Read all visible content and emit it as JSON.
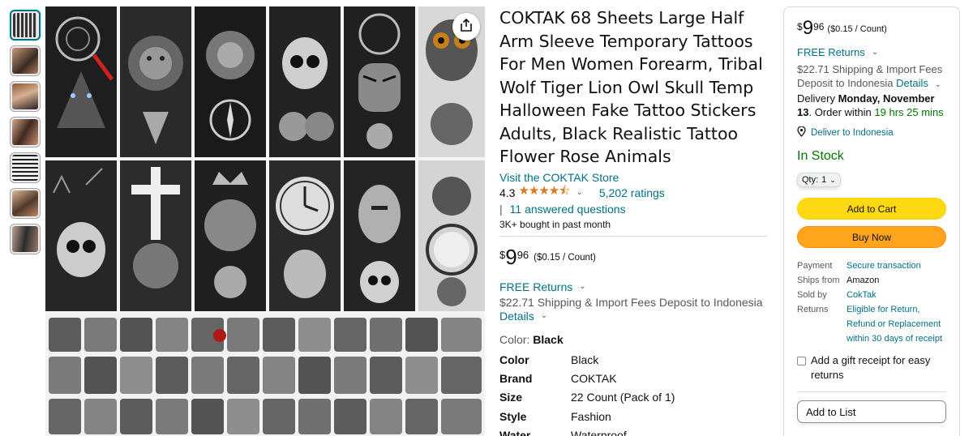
{
  "product": {
    "title": "COKTAK 68 Sheets Large Half Arm Sleeve Temporary Tattoos For Men Women Forearm, Tribal Wolf Tiger Lion Owl Skull Temp Halloween Fake Tattoo Stickers Adults, Black Realistic Tattoo Flower Rose Animals",
    "store_link": "Visit the COKTAK Store",
    "rating_value": "4.3",
    "stars": "★★★★⯪",
    "ratings_count": "5,202 ratings",
    "qa_separator": "|",
    "answered_questions": "11 answered questions",
    "bought": "3K+ bought in past month",
    "price": {
      "currency": "$",
      "whole": "9",
      "fraction": "96",
      "unit": "($0.15 / Count)"
    },
    "free_returns": "FREE Returns",
    "shipping": "$22.71 Shipping & Import Fees Deposit to Indonesia",
    "details_link": "Details",
    "color_label": "Color:",
    "color_value": "Black",
    "specs": [
      {
        "key": "Color",
        "value": "Black"
      },
      {
        "key": "Brand",
        "value": "COKTAK"
      },
      {
        "key": "Size",
        "value": "22 Count (Pack of 1)"
      },
      {
        "key": "Style",
        "value": "Fashion"
      },
      {
        "key": "Water",
        "value": "Waterproof"
      }
    ]
  },
  "buybox": {
    "price": {
      "currency": "$",
      "whole": "9",
      "fraction": "96",
      "unit": "($0.15 / Count)"
    },
    "free_returns": "FREE Returns",
    "shipping": "$22.71 Shipping & Import Fees Deposit to Indonesia",
    "details_link": "Details",
    "delivery_prefix": "Delivery",
    "delivery_date": "Monday, November 13",
    "order_within_prefix": ". Order within",
    "order_within_time": "19 hrs 25 mins",
    "deliver_to": "Deliver to Indonesia",
    "stock": "In Stock",
    "qty_label": "Qty:",
    "qty_value": "1",
    "add_to_cart": "Add to Cart",
    "buy_now": "Buy Now",
    "details": [
      {
        "key": "Payment",
        "value": "Secure transaction",
        "link": true
      },
      {
        "key": "Ships from",
        "value": "Amazon",
        "link": false
      },
      {
        "key": "Sold by",
        "value": "CokTak",
        "link": true
      },
      {
        "key": "Returns",
        "value": "Eligible for Return, Refund or Replacement within 30 days of receipt",
        "link": true
      }
    ],
    "gift_receipt": "Add a gift receipt for easy returns",
    "add_to_list": "Add to List"
  },
  "icons": {
    "share": "share-icon",
    "caret": "chevron-down-icon",
    "location": "location-pin-icon"
  },
  "colors": {
    "link": "#007185",
    "stars": "#de7921",
    "in_stock": "#007600",
    "cart_button": "#ffd814",
    "buy_button": "#ffa41c"
  },
  "thumbnail_count": 7
}
